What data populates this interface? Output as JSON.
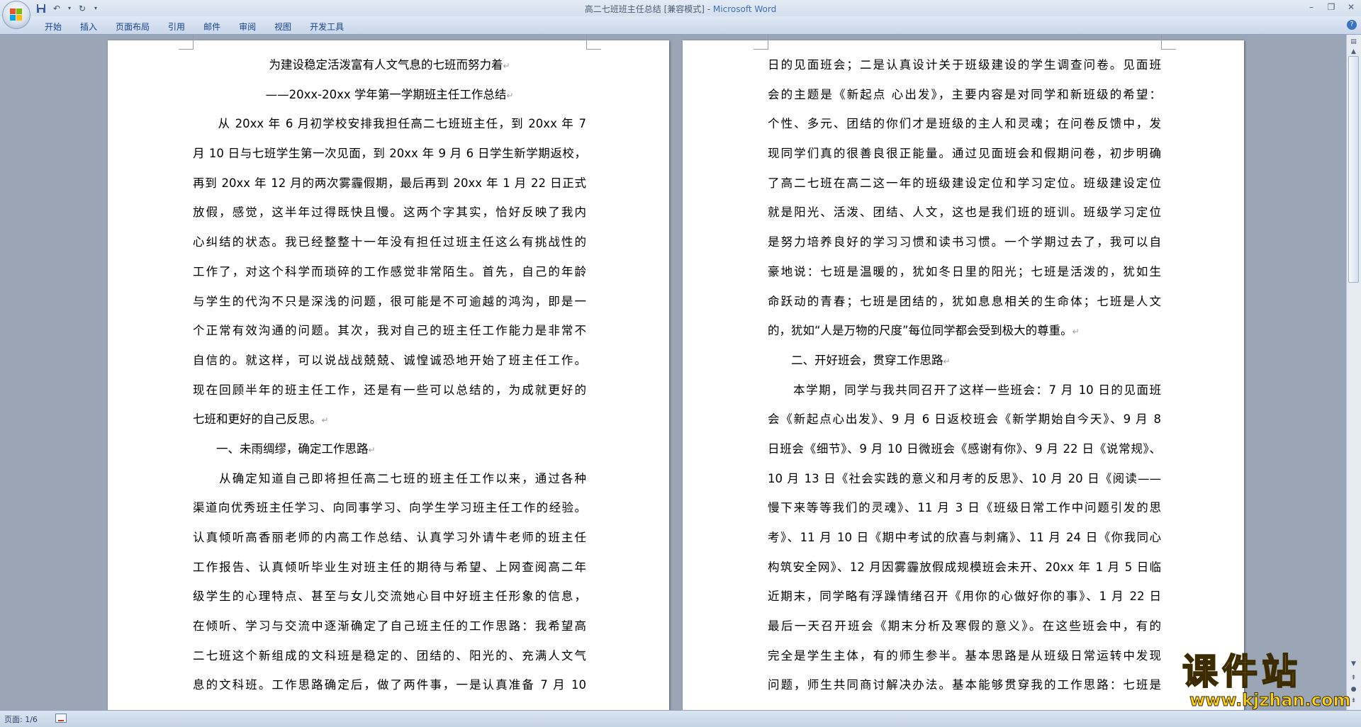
{
  "window": {
    "title": "高二七班班主任总结 [兼容模式] - ",
    "app_name": "Microsoft Word"
  },
  "ribbon": {
    "tabs": [
      "开始",
      "插入",
      "页面布局",
      "引用",
      "邮件",
      "审阅",
      "视图",
      "开发工具"
    ]
  },
  "pages": [
    {
      "lines": [
        {
          "text": "为建设稳定活泼富有人文气息的七班而努力着",
          "align": "center",
          "pm": true
        },
        {
          "text": "——20xx-20xx 学年第一学期班主任工作总结",
          "align": "center",
          "pm": true
        },
        {
          "text": "　　从 20xx 年 6 月初学校安排我担任高二七班班主任，到 20xx 年 7"
        },
        {
          "text": "月 10 日与七班学生第一次见面，到 20xx 年 9 月 6 日学生新学期返校，"
        },
        {
          "text": "再到 20xx 年 12 月的两次雾霾假期，最后再到 20xx 年 1 月 22 日正式"
        },
        {
          "text": "放假，感觉，这半年过得既快且慢。这两个字其实，恰好反映了我内"
        },
        {
          "text": "心纠结的状态。我已经整整十一年没有担任过班主任这么有挑战性的"
        },
        {
          "text": "工作了，对这个科学而琐碎的工作感觉非常陌生。首先，自己的年龄"
        },
        {
          "text": "与学生的代沟不只是深浅的问题，很可能是不可逾越的鸿沟，即是一"
        },
        {
          "text": "个正常有效沟通的问题。其次，我对自己的班主任工作能力是非常不"
        },
        {
          "text": "自信的。就这样，可以说战战兢兢、诚惶诚恐地开始了班主任工作。"
        },
        {
          "text": "现在回顾半年的班主任工作，还是有一些可以总结的，为成就更好的"
        },
        {
          "text": "七班和更好的自己反思。",
          "align": "last",
          "pm": true
        },
        {
          "text": "　　一、未雨绸缪，确定工作思路",
          "align": "last",
          "pm": true
        },
        {
          "text": "　　从确定知道自己即将担任高二七班的班主任工作以来，通过各种"
        },
        {
          "text": "渠道向优秀班主任学习、向同事学习、向学生学习班主任工作的经验。"
        },
        {
          "text": "认真倾听高香丽老师的内高工作总结、认真学习外请牛老师的班主任"
        },
        {
          "text": "工作报告、认真倾听毕业生对班主任的期待与希望、上网查阅高二年"
        },
        {
          "text": "级学生的心理特点、甚至与女儿交流她心目中好班主任形象的信息，"
        },
        {
          "text": "在倾听、学习与交流中逐渐确定了自己班主任的工作思路：我希望高"
        },
        {
          "text": "二七班这个新组成的文科班是稳定的、团结的、阳光的、充满人文气"
        },
        {
          "text": "息的文科班。工作思路确定后，做了两件事，一是认真准备 7 月 10"
        }
      ]
    },
    {
      "lines": [
        {
          "text": "日的见面班会；二是认真设计关于班级建设的学生调查问卷。见面班"
        },
        {
          "text": "会的主题是《新起点  心出发》，主要内容是对同学和新班级的希望："
        },
        {
          "text": "个性、多元、团结的你们才是班级的主人和灵魂；在问卷反馈中，发"
        },
        {
          "text": "现同学们真的很善良很正能量。通过见面班会和假期问卷，初步明确"
        },
        {
          "text": "了高二七班在高二这一年的班级建设定位和学习定位。班级建设定位"
        },
        {
          "text": "就是阳光、活泼、团结、人文，这也是我们班的班训。班级学习定位"
        },
        {
          "text": "是努力培养良好的学习习惯和读书习惯。一个学期过去了，我可以自"
        },
        {
          "text": "豪地说：七班是温暖的，犹如冬日里的阳光；七班是活泼的，犹如生"
        },
        {
          "text": "命跃动的青春；七班是团结的，犹如息息相关的生命体；七班是人文"
        },
        {
          "text": "的，犹如“人是万物的尺度”每位同学都会受到极大的尊重。",
          "align": "last",
          "pm": true
        },
        {
          "text": "　　二、开好班会，贯穿工作思路",
          "align": "last",
          "pm": true
        },
        {
          "text": "　　本学期，同学与我共同召开了这样一些班会：7 月 10 日的见面班"
        },
        {
          "text": "会《新起点心出发》、9 月 6 日返校班会《新学期始自今天》、9 月 8"
        },
        {
          "text": "日班会《细节》、9 月 10 日微班会《感谢有你》、9 月 22 日《说常规》、"
        },
        {
          "text": "10 月 13 日《社会实践的意义和月考的反思》、10 月 20 日《阅读——"
        },
        {
          "text": "慢下来等等我们的灵魂》、11 月 3 日《班级日常工作中问题引发的思"
        },
        {
          "text": "考》、11 月 10 日《期中考试的欣喜与刺痛》、11 月 24 日《你我同心"
        },
        {
          "text": "构筑安全网》、12 月因雾霾放假成规模班会未开、20xx 年 1 月 5 日临"
        },
        {
          "text": "近期末，同学略有浮躁情绪召开《用你的心做好你的事》、1 月 22 日"
        },
        {
          "text": "最后一天召开班会《期末分析及寒假的意义》。在这些班会中，有的"
        },
        {
          "text": "完全是学生主体，有的师生参半。基本思路是从班级日常运转中发现"
        },
        {
          "text": "问题，师生共同商讨解决办法。基本能够贯穿我的工作思路：七班是"
        }
      ]
    }
  ],
  "paragraph_mark": "↵",
  "status": {
    "page": "页面: 1/6"
  },
  "watermark": {
    "chars": "课件站",
    "url": "www.kjzhan.com"
  }
}
